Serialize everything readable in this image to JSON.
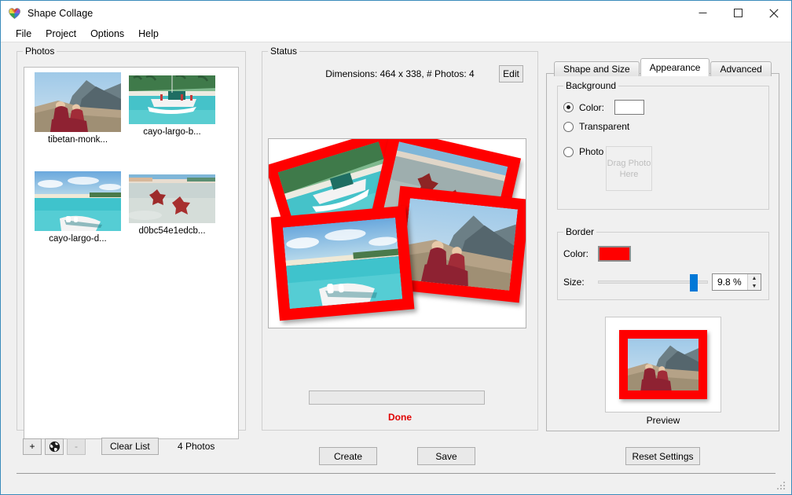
{
  "window": {
    "title": "Shape Collage",
    "icon": "shape-collage-logo",
    "controls": {
      "minimize": "minimize",
      "maximize": "maximize",
      "close": "close"
    }
  },
  "menu": {
    "items": [
      "File",
      "Project",
      "Options",
      "Help"
    ]
  },
  "photos": {
    "group_title": "Photos",
    "items": [
      {
        "name": "tibetan-monk...",
        "thumb": "tibetan-monks"
      },
      {
        "name": "cayo-largo-b...",
        "thumb": "catamaran-beach"
      },
      {
        "name": "cayo-largo-d...",
        "thumb": "boat-bow-lagoon"
      },
      {
        "name": "d0bc54e1edcb...",
        "thumb": "starfish-shallows"
      }
    ],
    "toolbar": {
      "add": "+",
      "web": "globe-icon",
      "remove": "-",
      "clear": "Clear List"
    },
    "count_label": "4 Photos"
  },
  "status": {
    "group_title": "Status",
    "dimensions_text": "Dimensions: 464 x 338, # Photos: 4",
    "edit_label": "Edit",
    "progress_value": 0,
    "state_text": "Done",
    "state_color": "#e00000"
  },
  "actions": {
    "create_label": "Create",
    "save_label": "Save",
    "reset_label": "Reset Settings"
  },
  "settings": {
    "tabs": [
      {
        "label": "Shape and Size",
        "active": false
      },
      {
        "label": "Appearance",
        "active": true
      },
      {
        "label": "Advanced",
        "active": false
      }
    ],
    "background": {
      "group_title": "Background",
      "options": [
        {
          "label": "Color:",
          "selected": true
        },
        {
          "label": "Transparent",
          "selected": false
        },
        {
          "label": "Photo",
          "selected": false
        }
      ],
      "color_value": "#ffffff",
      "drop_target_text": "Drag Photo Here"
    },
    "border": {
      "group_title": "Border",
      "color_label": "Color:",
      "color_value": "#ff0000",
      "size_label": "Size:",
      "size_value": "9.8 %",
      "slider_percent": 83
    },
    "preview": {
      "caption": "Preview",
      "border_color": "#ff0000"
    }
  }
}
